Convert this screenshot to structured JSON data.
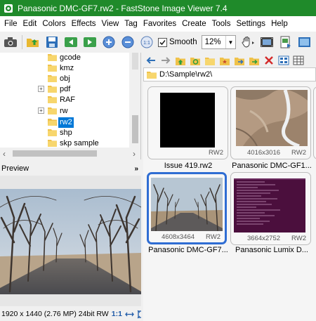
{
  "window": {
    "title": "Panasonic DMC-GF7.rw2  -  FastStone Image Viewer 7.4"
  },
  "menu": [
    "File",
    "Edit",
    "Colors",
    "Effects",
    "View",
    "Tag",
    "Favorites",
    "Create",
    "Tools",
    "Settings",
    "Help"
  ],
  "toolbar": {
    "smooth_label": "Smooth",
    "smooth_checked": true,
    "zoom_value": "12%"
  },
  "tree": {
    "items": [
      {
        "name": "gcode",
        "expandable": false,
        "selected": false
      },
      {
        "name": "kmz",
        "expandable": false,
        "selected": false
      },
      {
        "name": "obj",
        "expandable": false,
        "selected": false
      },
      {
        "name": "pdf",
        "expandable": true,
        "selected": false
      },
      {
        "name": "RAF",
        "expandable": false,
        "selected": false
      },
      {
        "name": "rw",
        "expandable": true,
        "selected": false
      },
      {
        "name": "rw2",
        "expandable": false,
        "selected": true
      },
      {
        "name": "shp",
        "expandable": false,
        "selected": false
      },
      {
        "name": "skp sample",
        "expandable": false,
        "selected": false
      }
    ]
  },
  "preview": {
    "label": "Preview",
    "collapse_glyph": "»",
    "status": "1920 x 1440 (2.76 MP)  24bit  RW",
    "ratio": "1:1"
  },
  "browser": {
    "path": "D:\\Sample\\rw2\\",
    "thumbnails": [
      {
        "caption": "Issue 419.rw2",
        "dims": "",
        "format": "RW2",
        "kind": "black",
        "selected": false
      },
      {
        "caption": "Panasonic DMC-GF1...",
        "dims": "4016x3016",
        "format": "RW2",
        "kind": "aerial",
        "selected": false
      },
      {
        "caption": "Panasonic DMC-GF7...",
        "dims": "4608x3464",
        "format": "RW2",
        "kind": "trees",
        "selected": true
      },
      {
        "caption": "Panasonic Lumix D...",
        "dims": "3664x2752",
        "format": "RW2",
        "kind": "terminal",
        "selected": false
      }
    ]
  },
  "colors": {
    "titlebar": "#1f8a2a",
    "selection": "#0078d7",
    "thumb_selected": "#2f6dd3"
  }
}
